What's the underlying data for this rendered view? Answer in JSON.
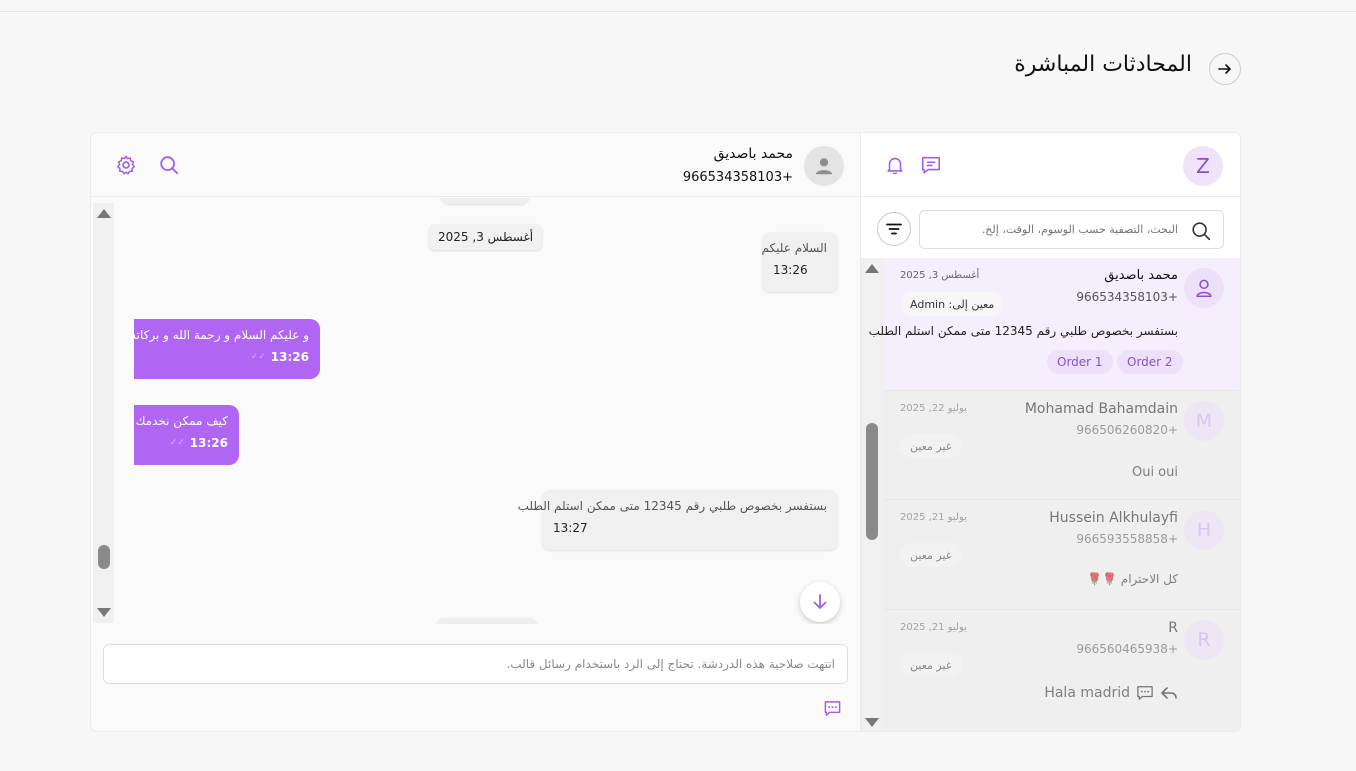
{
  "page": {
    "title": "المحادثات المباشرة"
  },
  "chat": {
    "contact_name": "محمد باصديق",
    "contact_phone": "966534358103+",
    "date_chip": "أغسطس 3, 2025",
    "messages": [
      {
        "direction": "in",
        "text": "السلام عليكم",
        "time": "13:26"
      },
      {
        "direction": "out",
        "text": "و عليكم السلام و رحمة الله و بركاته",
        "time": "13:26"
      },
      {
        "direction": "out",
        "text": "كيف ممكن نخدمك",
        "time": "13:26"
      },
      {
        "direction": "in",
        "text": "بستفسر بخصوص طلبي رقم 12345 متى ممكن استلم الطلب",
        "time": "13:27"
      }
    ],
    "composer_placeholder": "انتهت صلاحية هذه الدردشة. تحتاج إلى الرد باستخدام رسائل قالب."
  },
  "sidebar": {
    "user_initial": "Z",
    "search_placeholder": "البحث، التصفية حسب الوسوم، الوقت، إلخ.",
    "conversations": [
      {
        "name": "محمد باصديق",
        "phone": "966534358103+",
        "date": "أغسطس 3, 2025",
        "tag": "معين إلى: Admin",
        "last_message": "بستفسر بخصوص طلبي رقم 12345 متى ممكن استلم الطلب",
        "orders": [
          "Order 2",
          "Order 1"
        ]
      },
      {
        "initial": "M",
        "name": "Mohamad Bahamdain",
        "phone": "966506260820+",
        "date": "يوليو 22, 2025",
        "tag": "غير معين",
        "last_message": "Oui oui"
      },
      {
        "initial": "H",
        "name": "Hussein Alkhulayfi",
        "phone": "966593558858+",
        "date": "يوليو 21, 2025",
        "tag": "غير معين",
        "last_message": "كل الاحترام 🌹🌹"
      },
      {
        "initial": "R",
        "name": "R",
        "phone": "966560465938+",
        "date": "يوليو 21, 2025",
        "tag": "غير معين",
        "last_message": "Hala madrid"
      }
    ]
  },
  "colors": {
    "accent": "#b066f2",
    "accent_light": "#ede0fa"
  }
}
